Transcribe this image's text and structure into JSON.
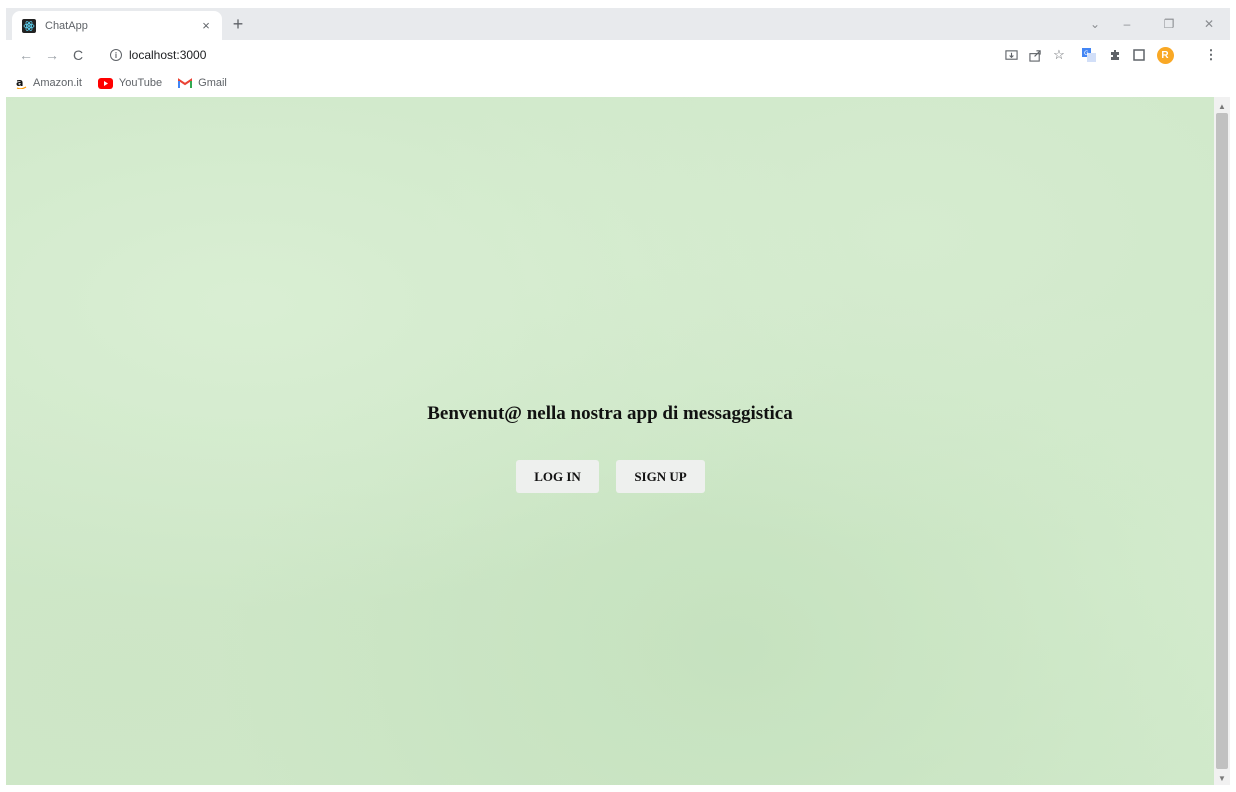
{
  "browser": {
    "tab": {
      "title": "ChatApp",
      "close": "×"
    },
    "new_tab": "+",
    "window_controls": {
      "down": "⌄",
      "minimize": "–",
      "restore": "❐",
      "close": "✕"
    },
    "nav": {
      "back": "←",
      "forward": "→",
      "reload": "C"
    },
    "url": "localhost:3000",
    "profile_initial": "R",
    "bookmarks": [
      {
        "label": "Amazon.it",
        "icon": "amazon-icon"
      },
      {
        "label": "YouTube",
        "icon": "youtube-icon"
      },
      {
        "label": "Gmail",
        "icon": "gmail-icon"
      }
    ],
    "colors": {
      "tabstrip": "#e8eaed",
      "profile": "#f9a825",
      "youtube": "#ff0000"
    }
  },
  "page": {
    "welcome": "Benvenut@ nella nostra app di messaggistica",
    "login_label": "LOG IN",
    "signup_label": "SIGN UP",
    "background_color": "#cfe8c9"
  }
}
